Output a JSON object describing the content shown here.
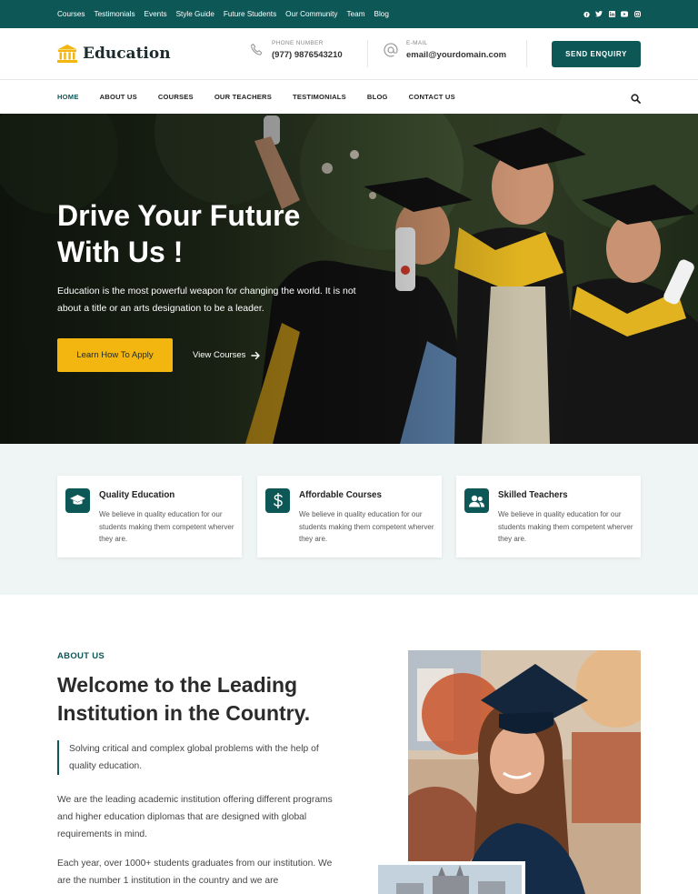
{
  "topbar": {
    "links": [
      "Courses",
      "Testimonials",
      "Events",
      "Style Guide",
      "Future Students",
      "Our Community",
      "Team",
      "Blog"
    ],
    "social_icons": [
      "facebook-icon",
      "twitter-icon",
      "linkedin-icon",
      "youtube-icon",
      "instagram-icon"
    ]
  },
  "header": {
    "logo_text": "Education",
    "phone": {
      "label": "PHONE NUMBER",
      "value": "(977) 9876543210"
    },
    "email": {
      "label": "E-MAIL",
      "value": "email@yourdomain.com"
    },
    "enquiry_button": "SEND ENQUIRY"
  },
  "nav": {
    "items": [
      "HOME",
      "ABOUT US",
      "COURSES",
      "OUR TEACHERS",
      "TESTIMONIALS",
      "BLOG",
      "CONTACT US"
    ],
    "active": "HOME"
  },
  "hero": {
    "title_line1": "Drive Your Future",
    "title_line2": "With Us !",
    "subtitle": "Education is the most powerful weapon for changing the world. It is not about a title or an arts designation to be a leader.",
    "primary_button": "Learn How To Apply",
    "secondary_button": "View Courses"
  },
  "features": [
    {
      "title": "Quality Education",
      "text": "We believe in quality education for our students making them competent wherver they are.",
      "icon": "graduation-cap-icon"
    },
    {
      "title": "Affordable Courses",
      "text": "We believe in quality education for our students making them competent wherver they are.",
      "icon": "dollar-icon"
    },
    {
      "title": "Skilled Teachers",
      "text": "We believe in quality education for our students making them competent wherver they are.",
      "icon": "users-icon"
    }
  ],
  "about": {
    "label": "ABOUT US",
    "title": "Welcome to the Leading Institution in the Country.",
    "quote": "Solving critical and complex global problems with the help of quality education.",
    "paragraph1": "We are the leading academic institution offering different programs and higher education diplomas that are designed with global requirements in mind.",
    "paragraph2": "Each year, over 1000+ students graduates from our institution. We are the number 1 institution in the country and we are"
  },
  "colors": {
    "brand": "#0d5757",
    "accent": "#f3b50f",
    "feature_bg": "#eff5f5"
  }
}
